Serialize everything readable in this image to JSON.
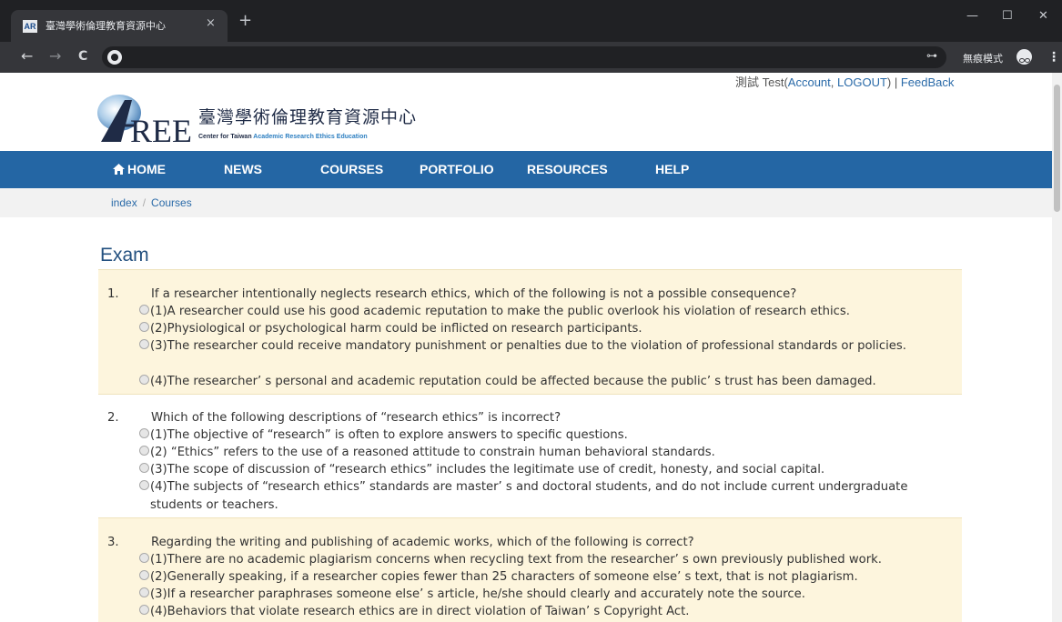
{
  "browser": {
    "tab_title": "臺灣學術倫理教育資源中心",
    "tab_favicon_text": "AR",
    "close_glyph": "×",
    "newtab_glyph": "+",
    "incognito_label": "無痕模式",
    "back_glyph": "←",
    "forward_glyph": "→",
    "reload_glyph": "C",
    "key_glyph": "⊶",
    "menu_glyph": "⋮",
    "minimize_glyph": "—",
    "maximize_glyph": "☐",
    "closewin_glyph": "✕"
  },
  "userbar": {
    "prefix": "測試 Test(",
    "account": "Account",
    "comma": ", ",
    "logout": "LOGOUT",
    "suffix": ") | ",
    "feedback": "FeedBack"
  },
  "logo": {
    "zh": "臺灣學術倫理教育資源中心",
    "en_parts": [
      "Center for Taiwan ",
      "Academic",
      " ",
      "Research",
      " ",
      "Ethics",
      " ",
      "Education"
    ],
    "mark_text": "REE"
  },
  "nav": {
    "home": "HOME",
    "news": "NEWS",
    "courses": "COURSES",
    "portfolio": "PORTFOLIO",
    "resources": "RESOURCES",
    "help": "HELP"
  },
  "breadcrumb": {
    "index": "index",
    "sep": "/",
    "courses": "Courses"
  },
  "page_title": "Exam",
  "questions": [
    {
      "num": "1.",
      "text": "If a researcher intentionally neglects research ethics, which of the following is not a possible consequence?",
      "options": [
        "(1)A researcher could use his good academic reputation to make the public overlook his violation of research ethics.",
        "(2)Physiological or psychological harm could be inflicted on research participants.",
        "(3)The researcher could receive mandatory punishment or penalties due to the violation of professional standards or policies.",
        "(4)The researcher’ s personal and academic reputation could be affected because the public’ s trust has been damaged."
      ]
    },
    {
      "num": "2.",
      "text": "Which of the following descriptions of “research ethics” is incorrect?",
      "options": [
        "(1)The objective of “research” is often to explore answers to specific questions.",
        "(2) “Ethics” refers to the use of a reasoned attitude to constrain human behavioral standards.",
        "(3)The scope of discussion of “research ethics” includes the legitimate use of credit, honesty, and social capital.",
        "(4)The subjects of “research ethics” standards are master’ s and doctoral students, and do not include current undergraduate students or teachers."
      ]
    },
    {
      "num": "3.",
      "text": "Regarding the writing and publishing of academic works, which of the following is correct?",
      "options": [
        "(1)There are no academic plagiarism concerns when recycling text from the researcher’ s own previously published work.",
        "(2)Generally speaking, if a researcher copies fewer than 25 characters of someone else’ s text, that is not plagiarism.",
        "(3)If a researcher paraphrases someone else’ s article, he/she should clearly and accurately note the source.",
        "(4)Behaviors that violate research ethics are in direct violation of Taiwan’ s Copyright Act."
      ]
    }
  ],
  "colors": {
    "nav_bg": "#2466a4",
    "title": "#23507f",
    "link": "#2a6aa8",
    "shaded_row": "#fdf5dd"
  }
}
